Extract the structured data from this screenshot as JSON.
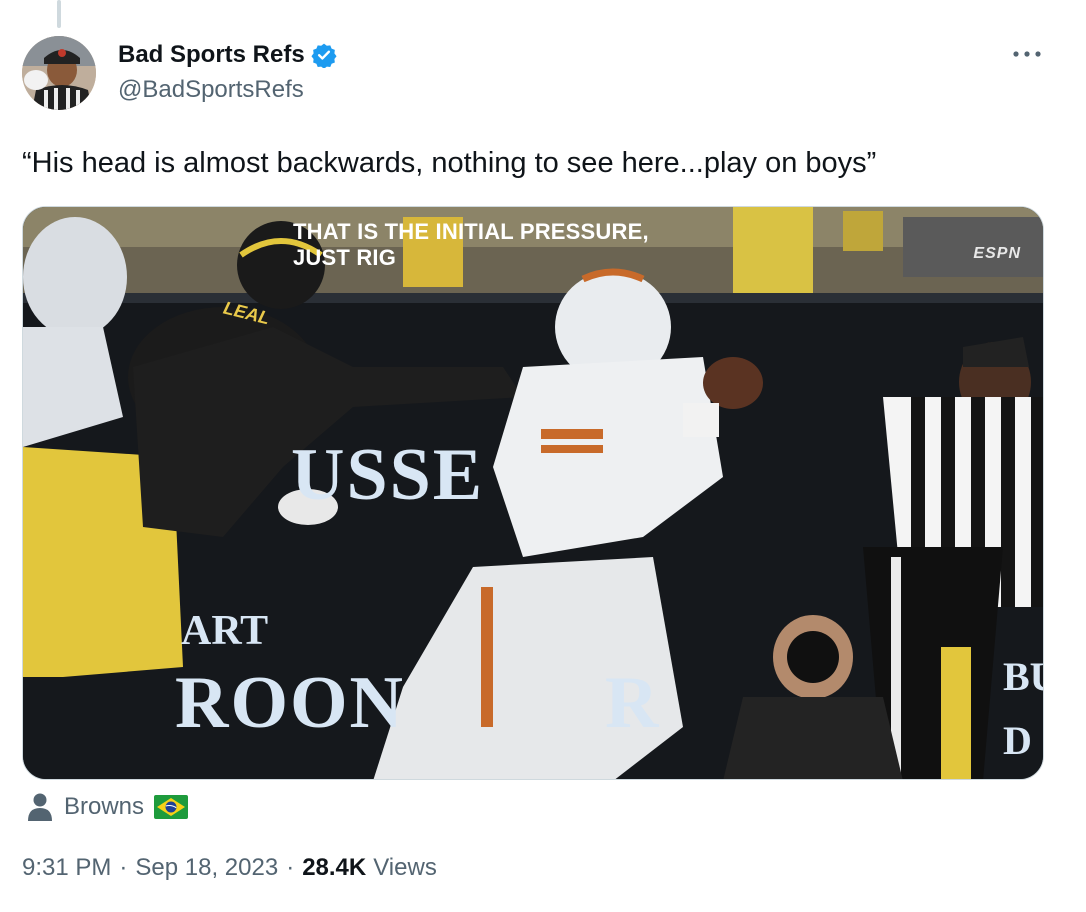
{
  "author": {
    "name": "Bad Sports Refs",
    "handle": "@BadSportsRefs",
    "verified": true,
    "verified_color": "#1d9bf0"
  },
  "tweet": {
    "text": "“His head is almost backwards, nothing to see here...play on boys”"
  },
  "media": {
    "caption_line1": "THAT IS THE INITIAL PRESSURE,",
    "caption_line2": "JUST RIG",
    "network_logo": "ESPN",
    "jersey_name": "LEAL",
    "wall_text_1": "USSE",
    "wall_text_2": "ART",
    "wall_text_3": "ROON",
    "wall_text_3b": "R",
    "wall_text_4a": "BU",
    "wall_text_4b": "D"
  },
  "location": {
    "icon": "person-icon",
    "text": "Browns",
    "flag_icon": "brazil-flag-icon"
  },
  "meta": {
    "time": "9:31 PM",
    "separator": "·",
    "date": "Sep 18, 2023",
    "views_count": "28.4K",
    "views_label": "Views"
  },
  "icons": {
    "more": "more-icon"
  },
  "colors": {
    "text_primary": "#0f1419",
    "text_secondary": "#536471",
    "border": "#cfd9de"
  }
}
